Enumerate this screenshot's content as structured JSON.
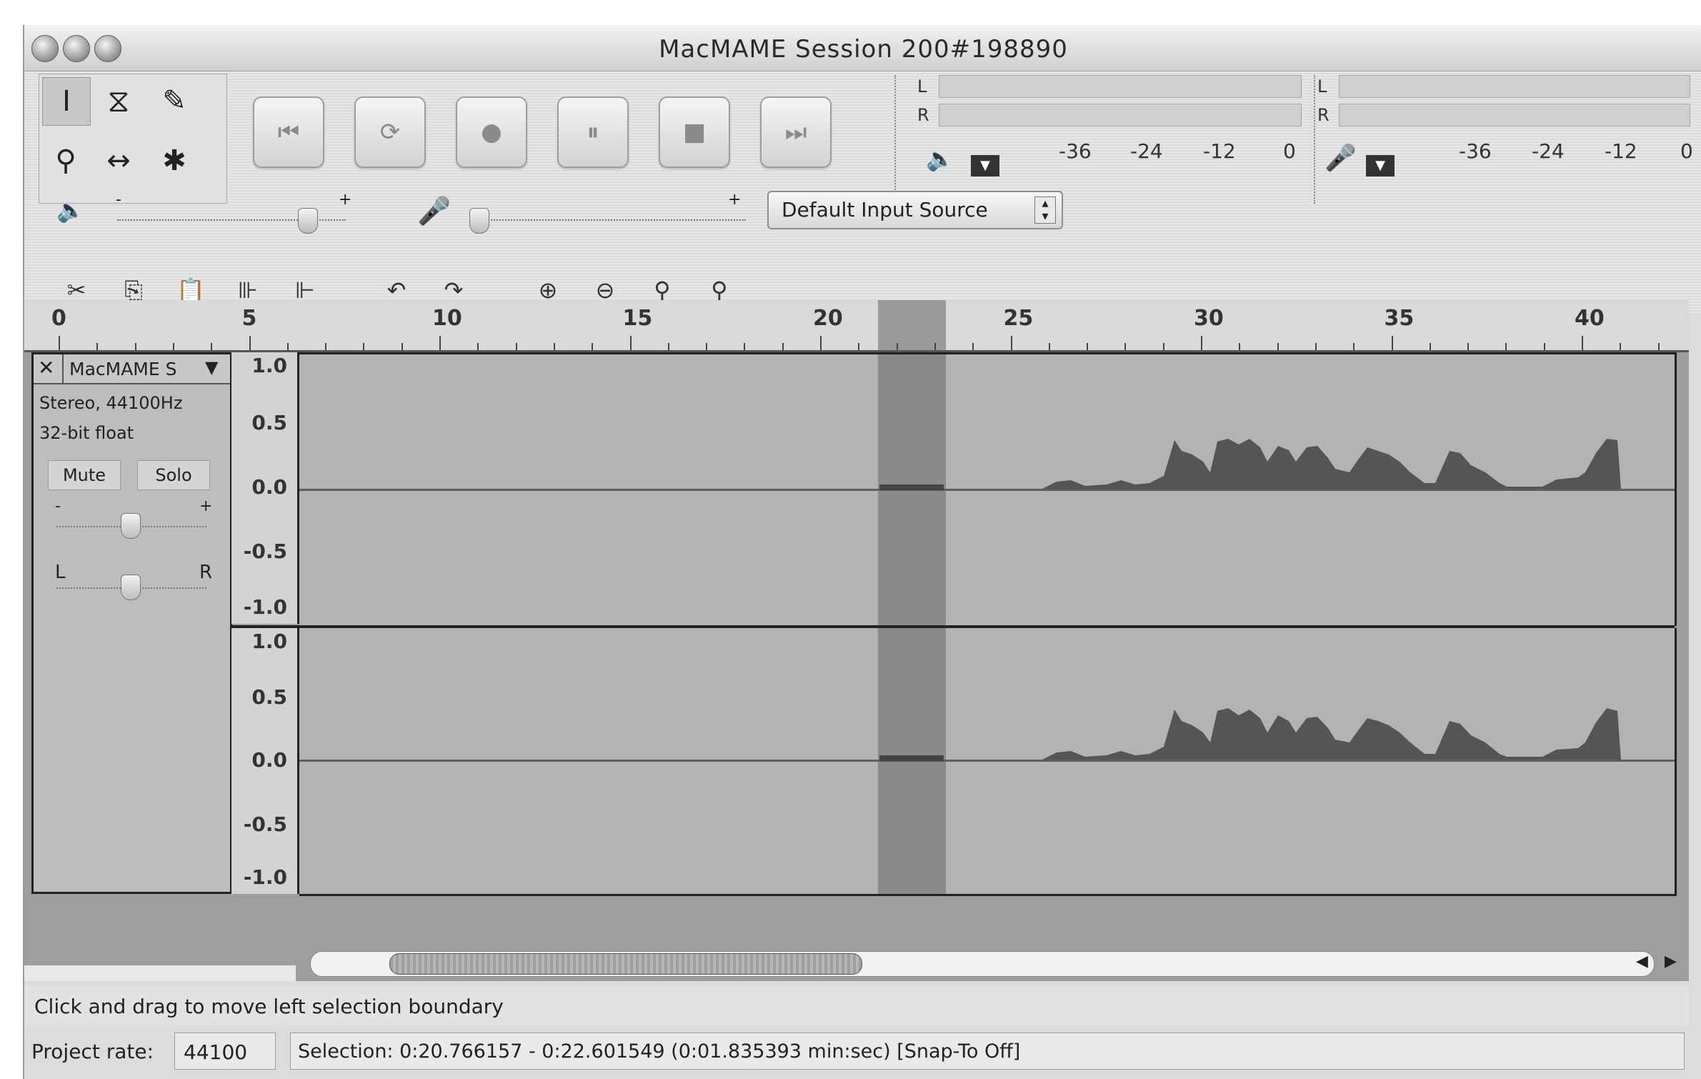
{
  "window": {
    "title": "MacMAME Session 200#198890"
  },
  "tools": [
    {
      "name": "selection-tool",
      "glyph": "I"
    },
    {
      "name": "envelope-tool",
      "glyph": "⧖"
    },
    {
      "name": "draw-tool",
      "glyph": "✎"
    },
    {
      "name": "zoom-tool",
      "glyph": "⚲"
    },
    {
      "name": "time-shift-tool",
      "glyph": "↔"
    },
    {
      "name": "multi-tool",
      "glyph": "✱"
    }
  ],
  "transport": [
    {
      "name": "skip-to-start",
      "glyph": "⏮"
    },
    {
      "name": "play",
      "glyph": "⟳"
    },
    {
      "name": "record",
      "glyph": "●"
    },
    {
      "name": "pause",
      "glyph": "⏸"
    },
    {
      "name": "stop",
      "glyph": "■"
    },
    {
      "name": "skip-to-end",
      "glyph": "⏭"
    }
  ],
  "meters": {
    "L": "L",
    "R": "R",
    "scale": [
      "-36",
      "-24",
      "-12",
      "0"
    ]
  },
  "mixer": {
    "input_source": "Default Input Source",
    "minus": "-",
    "plus": "+"
  },
  "ruler": {
    "labels": [
      "0",
      "5",
      "10",
      "15",
      "20",
      "25",
      "30",
      "35",
      "40"
    ]
  },
  "track": {
    "name": "MacMAME S",
    "close": "✕",
    "format": "Stereo, 44100Hz",
    "bitdepth": "32-bit float",
    "mute": "Mute",
    "solo": "Solo",
    "gain_minus": "-",
    "gain_plus": "+",
    "pan_left": "L",
    "pan_right": "R",
    "scale_labels": [
      "1.0",
      "0.5",
      "0.0",
      "-0.5",
      "-1.0"
    ]
  },
  "status": {
    "message": "Click and drag to move left selection boundary",
    "rate_label": "Project rate:",
    "rate_value": "44100",
    "selection": "Selection: 0:20.766157 - 0:22.601549 (0:01.835393 min:sec)   [Snap-To Off]"
  },
  "colors": {
    "waveform": "#555555",
    "background": "#b3b3b3",
    "selection": "#8a8a8a"
  }
}
